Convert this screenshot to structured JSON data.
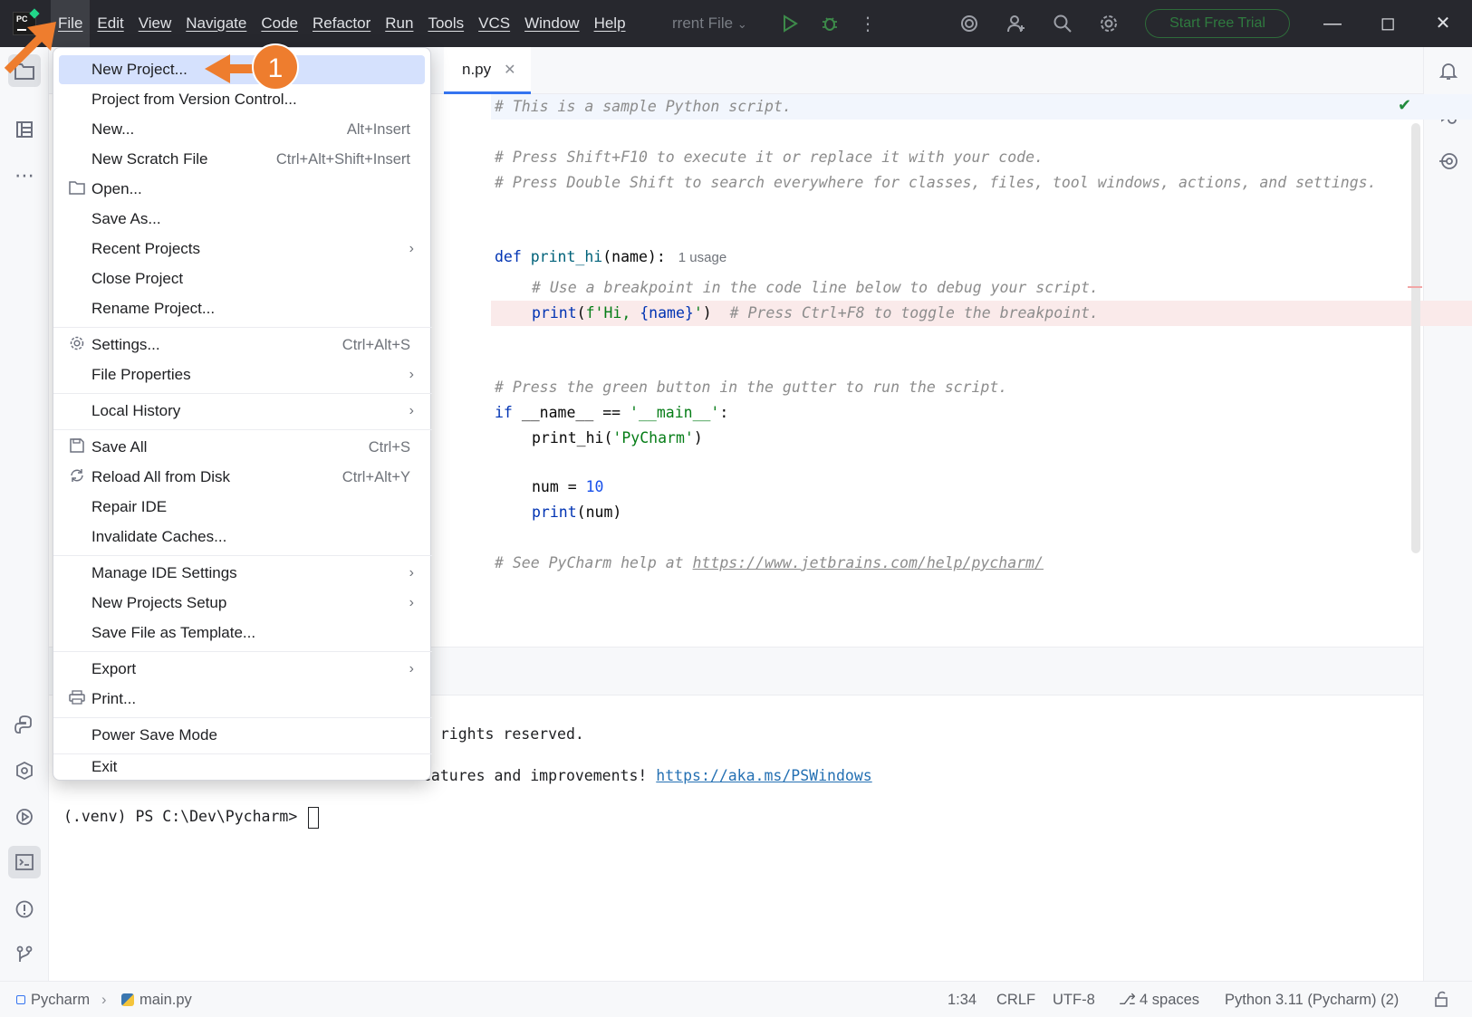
{
  "menubar": {
    "items": [
      "File",
      "Edit",
      "View",
      "Navigate",
      "Code",
      "Refactor",
      "Run",
      "Tools",
      "VCS",
      "Window",
      "Help"
    ],
    "run_config": "rrent File"
  },
  "toolbar": {
    "trial_label": "Start Free Trial"
  },
  "tab": {
    "title": "n.py"
  },
  "code": {
    "l1": "# This is a sample Python script.",
    "l2": "# Press Shift+F10 to execute it or replace it with your code.",
    "l3": "# Press Double Shift to search everywhere for classes, files, tool windows, actions, and settings.",
    "l4_kw": "def ",
    "l4_fn": "print_hi",
    "l4_rest": "(name):",
    "l4_hint": "1 usage",
    "l5": "# Use a breakpoint in the code line below to debug your script.",
    "l6_fn": "print",
    "l6_a": "(",
    "l6_str1": "f'Hi, ",
    "l6_b": "{name}",
    "l6_str2": "'",
    "l6_c": ")  ",
    "l6_cmt": "# Press Ctrl+F8 to toggle the breakpoint.",
    "l7": "# Press the green button in the gutter to run the script.",
    "l8_kw": "if ",
    "l8_rest": "__name__ == ",
    "l8_str": "'__main__'",
    "l8_end": ":",
    "l9_a": "print_hi(",
    "l9_str": "'PyCharm'",
    "l9_b": ")",
    "l10_a": "num = ",
    "l10_num": "10",
    "l11_fn": "print",
    "l11_rest": "(num)",
    "l12_cmt": "# See PyCharm help at ",
    "l12_link": "https://www.jetbrains.com/help/pycharm/"
  },
  "terminal": {
    "line1": "l rights reserved.",
    "line2_text": "eatures and improvements! ",
    "line2_link": "https://aka.ms/PSWindows",
    "prompt": "(.venv) PS C:\\Dev\\Pycharm> "
  },
  "file_menu": {
    "items": [
      {
        "label": "New Project...",
        "shortcut": "",
        "submenu": false,
        "icon": ""
      },
      {
        "label": "Project from Version Control...",
        "shortcut": "",
        "submenu": false,
        "icon": ""
      },
      {
        "label": "New...",
        "shortcut": "Alt+Insert",
        "submenu": false,
        "icon": ""
      },
      {
        "label": "New Scratch File",
        "shortcut": "Ctrl+Alt+Shift+Insert",
        "submenu": false,
        "icon": ""
      },
      {
        "label": "Open...",
        "shortcut": "",
        "submenu": false,
        "icon": "folder-icon"
      },
      {
        "label": "Save As...",
        "shortcut": "",
        "submenu": false,
        "icon": ""
      },
      {
        "label": "Recent Projects",
        "shortcut": "",
        "submenu": true,
        "icon": ""
      },
      {
        "label": "Close Project",
        "shortcut": "",
        "submenu": false,
        "icon": ""
      },
      {
        "label": "Rename Project...",
        "shortcut": "",
        "submenu": false,
        "icon": ""
      },
      {
        "label": "Settings...",
        "shortcut": "Ctrl+Alt+S",
        "submenu": false,
        "icon": "gear-icon"
      },
      {
        "label": "File Properties",
        "shortcut": "",
        "submenu": true,
        "icon": ""
      },
      {
        "label": "Local History",
        "shortcut": "",
        "submenu": true,
        "icon": ""
      },
      {
        "label": "Save All",
        "shortcut": "Ctrl+S",
        "submenu": false,
        "icon": "save-icon"
      },
      {
        "label": "Reload All from Disk",
        "shortcut": "Ctrl+Alt+Y",
        "submenu": false,
        "icon": "reload-icon"
      },
      {
        "label": "Repair IDE",
        "shortcut": "",
        "submenu": false,
        "icon": ""
      },
      {
        "label": "Invalidate Caches...",
        "shortcut": "",
        "submenu": false,
        "icon": ""
      },
      {
        "label": "Manage IDE Settings",
        "shortcut": "",
        "submenu": true,
        "icon": ""
      },
      {
        "label": "New Projects Setup",
        "shortcut": "",
        "submenu": true,
        "icon": ""
      },
      {
        "label": "Save File as Template...",
        "shortcut": "",
        "submenu": false,
        "icon": ""
      },
      {
        "label": "Export",
        "shortcut": "",
        "submenu": true,
        "icon": ""
      },
      {
        "label": "Print...",
        "shortcut": "",
        "submenu": false,
        "icon": "printer-icon"
      },
      {
        "label": "Power Save Mode",
        "shortcut": "",
        "submenu": false,
        "icon": ""
      },
      {
        "label": "Exit",
        "shortcut": "",
        "submenu": false,
        "icon": ""
      }
    ],
    "highlighted": "New Project..."
  },
  "annotation": {
    "step": "1",
    "color": "#EE7D2E"
  },
  "statusbar": {
    "project": "Pycharm",
    "file": "main.py",
    "position": "1:34",
    "line_sep": "CRLF",
    "encoding": "UTF-8",
    "indent": "4 spaces",
    "interpreter": "Python 3.11 (Pycharm) (2)"
  },
  "colors": {
    "titlebar": "#27282E",
    "highlight": "#D5E1FD",
    "accent": "#3574F0",
    "breakpoint_line": "#FAEAEA"
  }
}
